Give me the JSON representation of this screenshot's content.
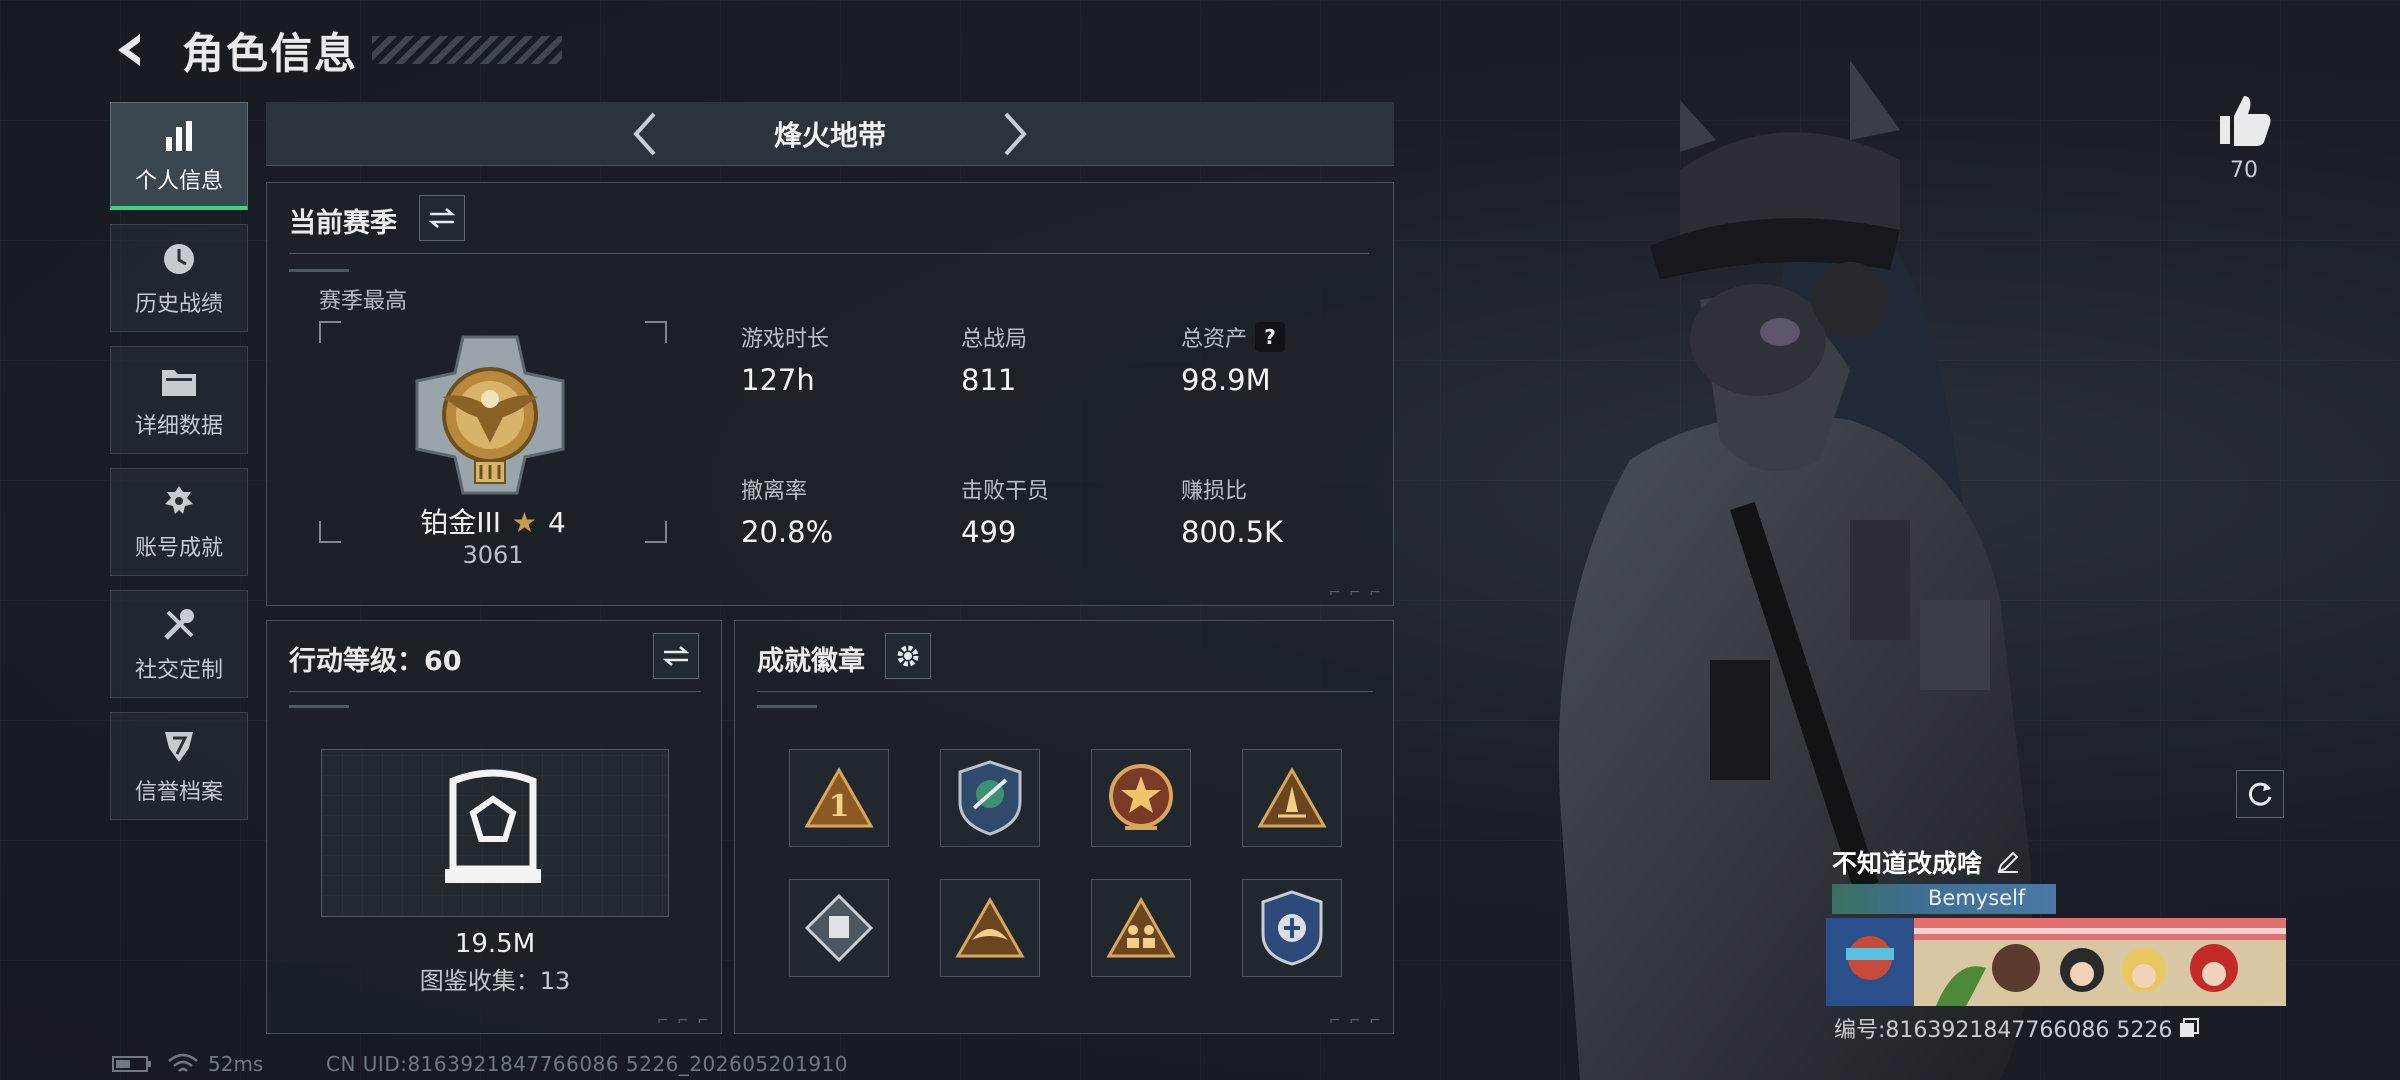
{
  "header": {
    "title": "角色信息"
  },
  "sidebar": {
    "items": [
      {
        "label": "个人信息",
        "icon": "bar-chart-icon",
        "active": true
      },
      {
        "label": "历史战绩",
        "icon": "clock-history-icon"
      },
      {
        "label": "详细数据",
        "icon": "folder-icon"
      },
      {
        "label": "账号成就",
        "icon": "achievement-icon"
      },
      {
        "label": "社交定制",
        "icon": "tools-icon"
      },
      {
        "label": "信誉档案",
        "icon": "reputation-icon"
      }
    ]
  },
  "map_selector": {
    "current": "烽火地带"
  },
  "season": {
    "title": "当前赛季",
    "best_label": "赛季最高",
    "rank": "铂金III",
    "stars": "4",
    "score": "3061",
    "stats": [
      {
        "label": "游戏时长",
        "value": "127h"
      },
      {
        "label": "总战局",
        "value": "811"
      },
      {
        "label": "总资产",
        "value": "98.9M",
        "help": "?"
      },
      {
        "label": "撤离率",
        "value": "20.8%"
      },
      {
        "label": "击败干员",
        "value": "499"
      },
      {
        "label": "赚损比",
        "value": "800.5K"
      }
    ]
  },
  "level": {
    "title": "行动等级：60",
    "value": "19.5M",
    "collection": "图鉴收集：13"
  },
  "badges": {
    "title": "成就徽章",
    "items": [
      {
        "icon": "triangle-number-one-badge-icon"
      },
      {
        "icon": "shield-emblem-badge-icon"
      },
      {
        "icon": "star-medallion-badge-icon"
      },
      {
        "icon": "triangle-rocket-badge-icon"
      },
      {
        "icon": "diamond-crest-badge-icon"
      },
      {
        "icon": "triangle-wings-badge-icon"
      },
      {
        "icon": "triangle-soldiers-badge-icon"
      },
      {
        "icon": "police-shield-badge-icon"
      }
    ]
  },
  "profile": {
    "likes": "70",
    "name": "不知道改成啥",
    "tag": "Bemyself",
    "id_label": "编号:8163921847766086 5226"
  },
  "footer": {
    "ping": "52ms",
    "uid": "CN UID:8163921847766086 5226_202605201910"
  },
  "colors": {
    "accent": "#3fd28e",
    "panel": "#1c2228",
    "gold": "#c89b4a"
  }
}
